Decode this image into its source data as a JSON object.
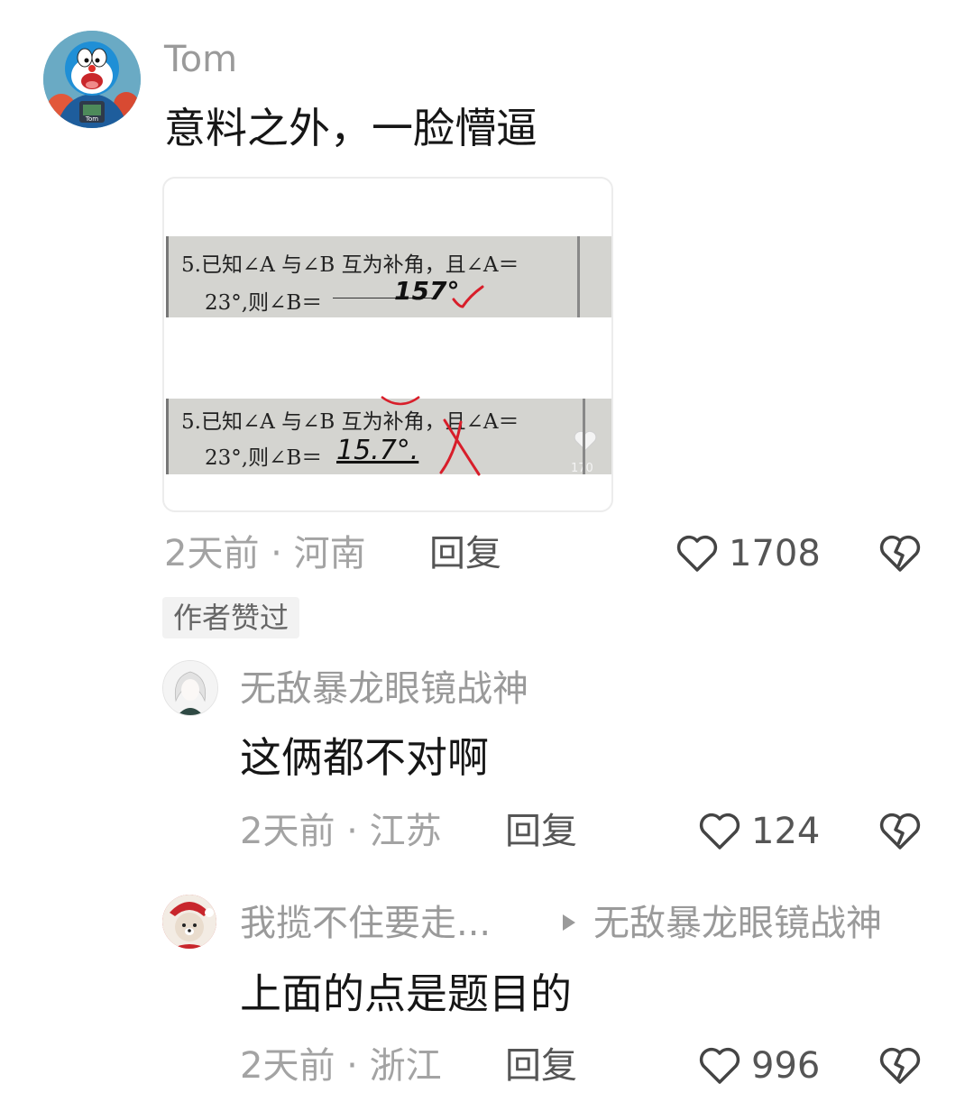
{
  "comments": [
    {
      "username": "Tom",
      "avatar_label": "Tom",
      "text": "意料之外，一脸懵逼",
      "meta": "2天前 · 河南",
      "reply_label": "回复",
      "likes": "1708",
      "badge": "作者赞过",
      "attachment": {
        "top_question_line1": "5.已知∠A 与∠B 互为补角，且∠A＝",
        "top_question_line2": "23°,则∠B＝",
        "top_answer": "157°",
        "bottom_question_line1": "5.已知∠A 与∠B 互为补角，且∠A＝",
        "bottom_question_line2": "23°,则∠B＝",
        "bottom_answer": "15.7°.",
        "like_count": "170"
      }
    },
    {
      "username": "无敌暴龙眼镜战神",
      "text": "这俩都不对啊",
      "meta": "2天前 · 江苏",
      "reply_label": "回复",
      "likes": "124"
    },
    {
      "username": "我揽不住要走...",
      "reply_to": "无敌暴龙眼镜战神",
      "text": "上面的点是题目的",
      "meta": "2天前 · 浙江",
      "reply_label": "回复",
      "likes": "996"
    }
  ],
  "icons": {
    "like": "heart-outline-icon",
    "dislike": "broken-heart-icon",
    "reply_arrow": "play-triangle-icon"
  },
  "colors": {
    "text": "#1a1a1a",
    "meta": "#a3a3a3",
    "badge_bg": "#f2f2f2",
    "check_red": "#d81e2a"
  }
}
